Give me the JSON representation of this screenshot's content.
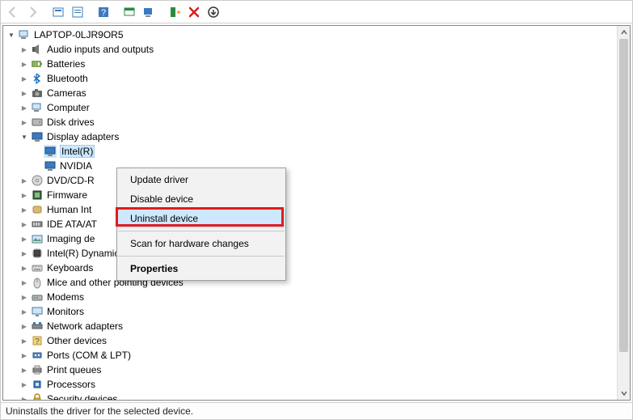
{
  "root": {
    "name": "LAPTOP-0LJR9OR5"
  },
  "categories": [
    {
      "label": "Audio inputs and outputs",
      "icon": "speaker",
      "expanded": false
    },
    {
      "label": "Batteries",
      "icon": "battery",
      "expanded": false
    },
    {
      "label": "Bluetooth",
      "icon": "bluetooth",
      "expanded": false
    },
    {
      "label": "Cameras",
      "icon": "camera",
      "expanded": false
    },
    {
      "label": "Computer",
      "icon": "computer",
      "expanded": false
    },
    {
      "label": "Disk drives",
      "icon": "disk",
      "expanded": false
    },
    {
      "label": "Display adapters",
      "icon": "display",
      "expanded": true,
      "children": [
        {
          "label": "Intel(R)",
          "icon": "display",
          "selected": true
        },
        {
          "label": "NVIDIA",
          "icon": "display",
          "selected": false
        }
      ]
    },
    {
      "label": "DVD/CD-R",
      "icon": "dvd",
      "expanded": false,
      "truncated": true
    },
    {
      "label": "Firmware",
      "icon": "firmware",
      "expanded": false,
      "truncated": true
    },
    {
      "label": "Human Int",
      "icon": "hid",
      "expanded": false,
      "truncated": true
    },
    {
      "label": "IDE ATA/AT",
      "icon": "ide",
      "expanded": false,
      "truncated": true
    },
    {
      "label": "Imaging de",
      "icon": "imaging",
      "expanded": false,
      "truncated": true
    },
    {
      "label": "Intel(R) Dynamic Platform and Thermal Framework",
      "icon": "chip",
      "expanded": false
    },
    {
      "label": "Keyboards",
      "icon": "keyboard",
      "expanded": false
    },
    {
      "label": "Mice and other pointing devices",
      "icon": "mouse",
      "expanded": false
    },
    {
      "label": "Modems",
      "icon": "modem",
      "expanded": false
    },
    {
      "label": "Monitors",
      "icon": "monitor",
      "expanded": false
    },
    {
      "label": "Network adapters",
      "icon": "network",
      "expanded": false
    },
    {
      "label": "Other devices",
      "icon": "other",
      "expanded": false
    },
    {
      "label": "Ports (COM & LPT)",
      "icon": "port",
      "expanded": false
    },
    {
      "label": "Print queues",
      "icon": "printer",
      "expanded": false
    },
    {
      "label": "Processors",
      "icon": "cpu",
      "expanded": false
    },
    {
      "label": "Security devices",
      "icon": "security",
      "expanded": false
    }
  ],
  "context_menu": {
    "items": [
      {
        "label": "Update driver",
        "highlighted": false
      },
      {
        "label": "Disable device",
        "highlighted": false
      },
      {
        "label": "Uninstall device",
        "highlighted": true,
        "annotated": true
      },
      {
        "sep": true
      },
      {
        "label": "Scan for hardware changes",
        "highlighted": false
      },
      {
        "sep": true
      },
      {
        "label": "Properties",
        "highlighted": false,
        "bold": true
      }
    ]
  },
  "status_bar": {
    "text": "Uninstalls the driver for the selected device."
  },
  "toolbar_icons": [
    "back",
    "forward",
    "sep",
    "show-hidden",
    "properties-icon",
    "sep",
    "help",
    "sep",
    "action1",
    "monitor-icon",
    "sep",
    "refresh",
    "delete",
    "more"
  ]
}
